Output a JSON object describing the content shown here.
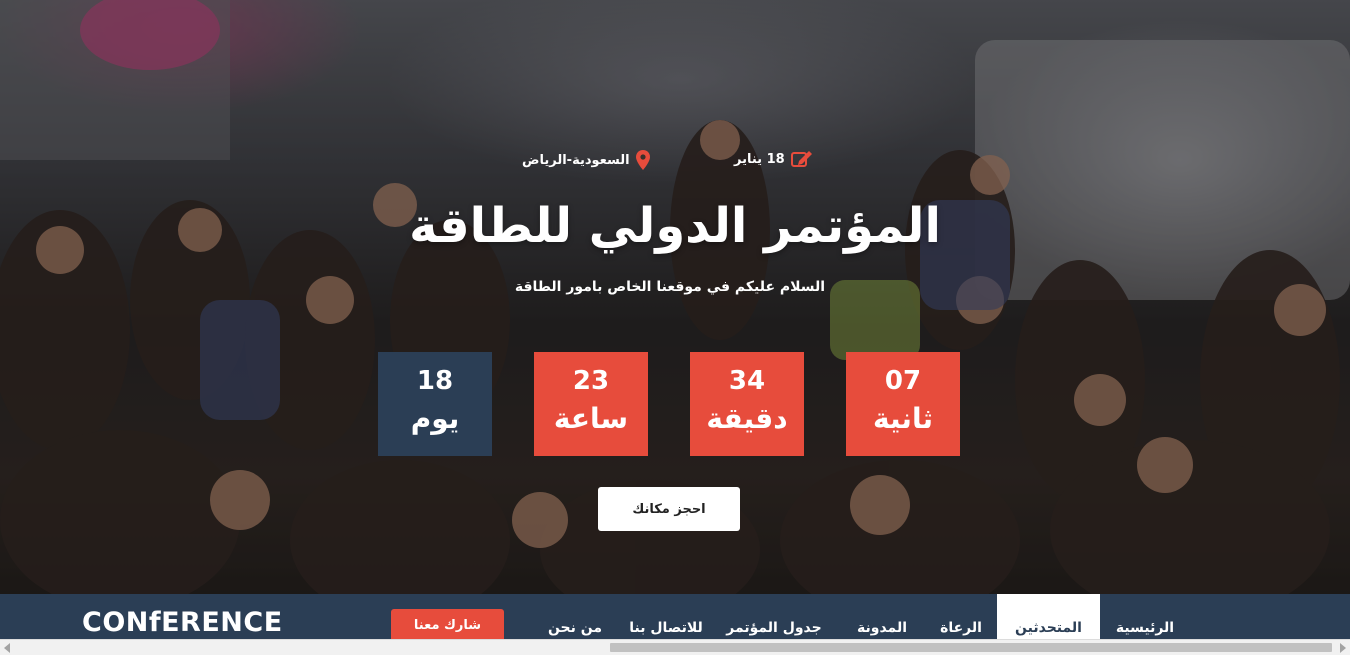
{
  "hero": {
    "date": "18 يناير",
    "location": "السعودية-الرياض",
    "title": "المؤتمر الدولي للطاقة",
    "subtitle": "السلام عليكم في موقعنا الخاص بامور الطاقة",
    "book_button": "احجز مكانك"
  },
  "countdown": {
    "days": {
      "value": "18",
      "label": "يوم"
    },
    "hours": {
      "value": "23",
      "label": "ساعة"
    },
    "minutes": {
      "value": "34",
      "label": "دقيقة"
    },
    "seconds": {
      "value": "07",
      "label": "ثانية"
    }
  },
  "navbar": {
    "logo": "CONfERENCE",
    "share_button": "شارك معنا",
    "items": [
      {
        "label": "الرئيسية"
      },
      {
        "label": "المتحدثين"
      },
      {
        "label": "الرعاة"
      },
      {
        "label": "المدونة"
      },
      {
        "label": "جدول المؤتمر"
      },
      {
        "label": "للاتصال بنا"
      },
      {
        "label": "من نحن"
      }
    ],
    "active_item": "المتحدثين"
  },
  "colors": {
    "accent_red": "#e74c3c",
    "navy": "#2b3e55",
    "white": "#ffffff"
  },
  "icons": {
    "date": "edit-pencil-icon",
    "location": "map-pin-icon"
  }
}
